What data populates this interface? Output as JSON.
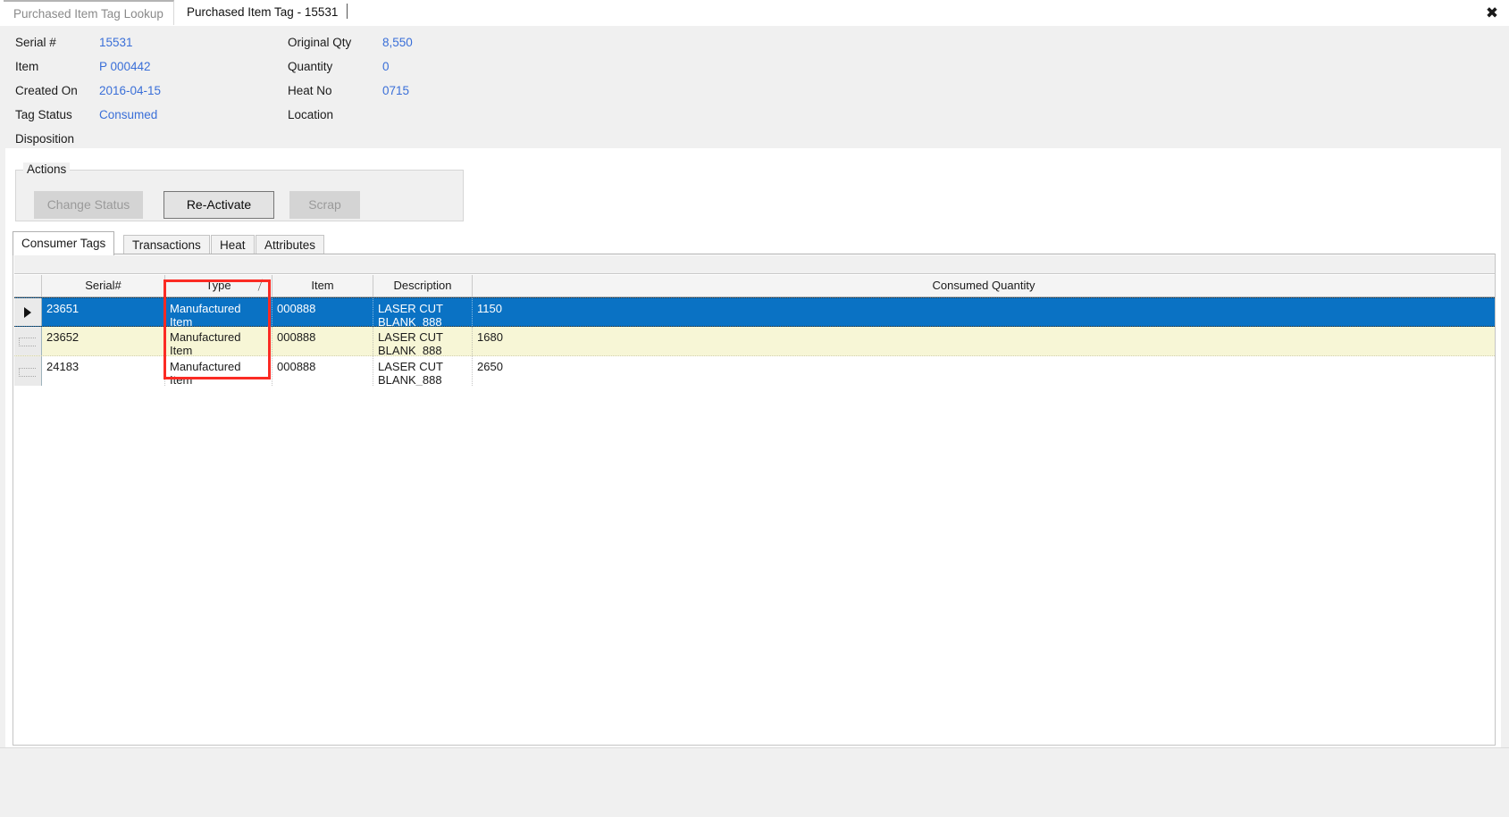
{
  "window": {
    "close_label": "✖"
  },
  "doc_tabs": [
    {
      "label": "Purchased Item Tag Lookup",
      "active": false
    },
    {
      "label": "Purchased Item Tag - 15531",
      "active": true
    }
  ],
  "detail": {
    "left_fields": [
      {
        "label": "Serial #",
        "value": "15531"
      },
      {
        "label": "Item",
        "value": "P 000442"
      },
      {
        "label": "Created On",
        "value": "2016-04-15"
      },
      {
        "label": "Tag Status",
        "value": "Consumed"
      },
      {
        "label": "Disposition",
        "value": ""
      }
    ],
    "right_fields": [
      {
        "label": "Original Qty",
        "value": "8,550"
      },
      {
        "label": "Quantity",
        "value": "0"
      },
      {
        "label": "Heat No",
        "value": "0715"
      },
      {
        "label": "Location",
        "value": ""
      }
    ],
    "value_color": "#3a6fd8"
  },
  "actions": {
    "legend": "Actions",
    "buttons": [
      {
        "label": "Change Status",
        "enabled": false
      },
      {
        "label": "Re-Activate",
        "enabled": true
      },
      {
        "label": "Scrap",
        "enabled": false
      }
    ]
  },
  "lower_tabs": [
    {
      "label": "Consumer Tags",
      "selected": true
    },
    {
      "label": "Transactions",
      "selected": false
    },
    {
      "label": "Heat",
      "selected": false
    },
    {
      "label": "Attributes",
      "selected": false
    }
  ],
  "grid": {
    "columns": [
      {
        "label": "Serial#",
        "sorted": false
      },
      {
        "label": "Type",
        "sorted": true,
        "sort_glyph": "╱"
      },
      {
        "label": "Item",
        "sorted": false
      },
      {
        "label": "Description",
        "sorted": false
      },
      {
        "label": "Consumed Quantity",
        "sorted": false
      }
    ],
    "rows": [
      {
        "state": "selected",
        "serial": "23651",
        "type": "Manufactured\nItem",
        "item": "000888",
        "description": "LASER CUT\nBLANK_888",
        "consumed_quantity": "1150"
      },
      {
        "state": "alternate",
        "serial": "23652",
        "type": "Manufactured\nItem",
        "item": "000888",
        "description": "LASER CUT\nBLANK_888",
        "consumed_quantity": "1680"
      },
      {
        "state": "normal",
        "serial": "24183",
        "type": "Manufactured\nItem",
        "item": "000888",
        "description": "LASER CUT\nBLANK_888",
        "consumed_quantity": "2650"
      }
    ],
    "selection_color": "#0a72c4",
    "alternate_row_color": "#f7f6d6"
  },
  "annotation": {
    "highlight_color": "#fb2b24",
    "target_column": "Type"
  }
}
